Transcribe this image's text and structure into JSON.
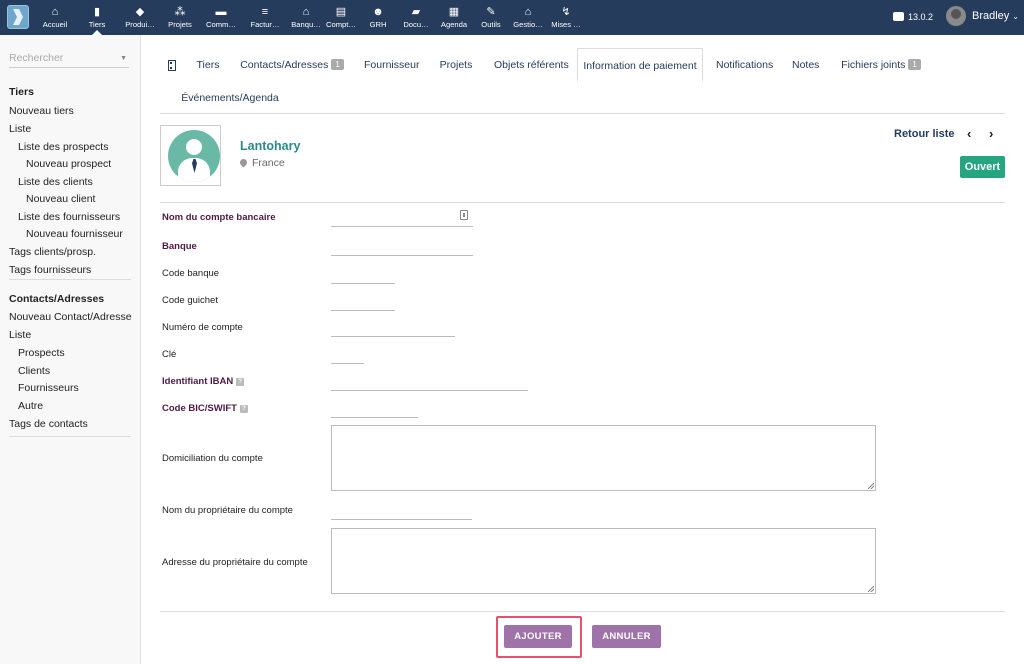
{
  "topbar": {
    "modules": [
      {
        "label": "Accueil",
        "icon": "home-icon",
        "glyph": "⌂"
      },
      {
        "label": "Tiers",
        "icon": "building-icon",
        "glyph": "▮"
      },
      {
        "label": "Produi…",
        "icon": "cube-icon",
        "glyph": "◆"
      },
      {
        "label": "Projets",
        "icon": "sitemap-icon",
        "glyph": "⁂"
      },
      {
        "label": "Comm…",
        "icon": "suitcase-icon",
        "glyph": "▬"
      },
      {
        "label": "Factur…",
        "icon": "money-icon",
        "glyph": "≡"
      },
      {
        "label": "Banqu…",
        "icon": "bank-icon",
        "glyph": "⌂"
      },
      {
        "label": "Compt…",
        "icon": "ledger-icon",
        "glyph": "▤"
      },
      {
        "label": "GRH",
        "icon": "users-icon",
        "glyph": "☻"
      },
      {
        "label": "Docu…",
        "icon": "folder-icon",
        "glyph": "▰"
      },
      {
        "label": "Agenda",
        "icon": "calendar-icon",
        "glyph": "▦"
      },
      {
        "label": "Outils",
        "icon": "wrench-icon",
        "glyph": "✎"
      },
      {
        "label": "Gestio…",
        "icon": "store-icon",
        "glyph": "⌂"
      },
      {
        "label": "Mises …",
        "icon": "update-icon",
        "glyph": "↯"
      }
    ],
    "active_module": "Tiers",
    "version": "13.0.2",
    "username": "Bradley"
  },
  "leftmenu": {
    "search_placeholder": "Rechercher",
    "items": [
      {
        "label": "Tiers",
        "level": 0,
        "title": true
      },
      {
        "label": "Nouveau tiers",
        "level": 0
      },
      {
        "label": "Liste",
        "level": 0
      },
      {
        "label": "Liste des prospects",
        "level": 1
      },
      {
        "label": "Nouveau prospect",
        "level": 2
      },
      {
        "label": "Liste des clients",
        "level": 1
      },
      {
        "label": "Nouveau client",
        "level": 2
      },
      {
        "label": "Liste des fournisseurs",
        "level": 1
      },
      {
        "label": "Nouveau fournisseur",
        "level": 2
      },
      {
        "label": "Tags clients/prosp.",
        "level": 0
      },
      {
        "label": "Tags fournisseurs",
        "level": 0
      },
      {
        "label": "Contacts/Adresses",
        "level": 0,
        "title": true
      },
      {
        "label": "Nouveau Contact/Adresse",
        "level": 0
      },
      {
        "label": "Liste",
        "level": 0
      },
      {
        "label": "Prospects",
        "level": 1
      },
      {
        "label": "Clients",
        "level": 1
      },
      {
        "label": "Fournisseurs",
        "level": 1
      },
      {
        "label": "Autre",
        "level": 1
      },
      {
        "label": "Tags de contacts",
        "level": 0
      }
    ]
  },
  "tabs": [
    {
      "label": "Tiers"
    },
    {
      "label": "Contacts/Adresses",
      "badge": "1"
    },
    {
      "label": "Fournisseur"
    },
    {
      "label": "Projets"
    },
    {
      "label": "Objets référents"
    },
    {
      "label": "Information de paiement",
      "active": true
    },
    {
      "label": "Notifications"
    },
    {
      "label": "Notes"
    },
    {
      "label": "Fichiers joints",
      "badge": "1"
    },
    {
      "label": "Événements/Agenda"
    }
  ],
  "thirdparty": {
    "name": "Lantohary",
    "country": "France",
    "status": "Ouvert",
    "back_label": "Retour liste",
    "prev": "‹",
    "next": "›"
  },
  "form": {
    "fields": [
      {
        "label": "Nom du compte bancaire",
        "required": true,
        "value": ""
      },
      {
        "label": "Banque",
        "required": true,
        "value": ""
      },
      {
        "label": "Code banque",
        "value": ""
      },
      {
        "label": "Code guichet",
        "value": ""
      },
      {
        "label": "Numéro de compte",
        "value": ""
      },
      {
        "label": "Clé",
        "value": ""
      },
      {
        "label": "Identifiant IBAN",
        "required": true,
        "help": true,
        "value": ""
      },
      {
        "label": "Code BIC/SWIFT",
        "required": true,
        "help": true,
        "value": ""
      },
      {
        "label": "Domiciliation du compte",
        "type": "textarea",
        "value": ""
      },
      {
        "label": "Nom du propriétaire du compte",
        "value": ""
      },
      {
        "label": "Adresse du propriétaire du compte",
        "type": "textarea",
        "value": ""
      }
    ]
  },
  "buttons": {
    "add": "AJOUTER",
    "cancel": "ANNULER"
  },
  "colors": {
    "topbar": "#263c5c",
    "button": "#9f72a9",
    "status": "#25a580",
    "highlight": "#e7526b",
    "required_label": "#4f1a44",
    "name": "#2b8a8a"
  }
}
